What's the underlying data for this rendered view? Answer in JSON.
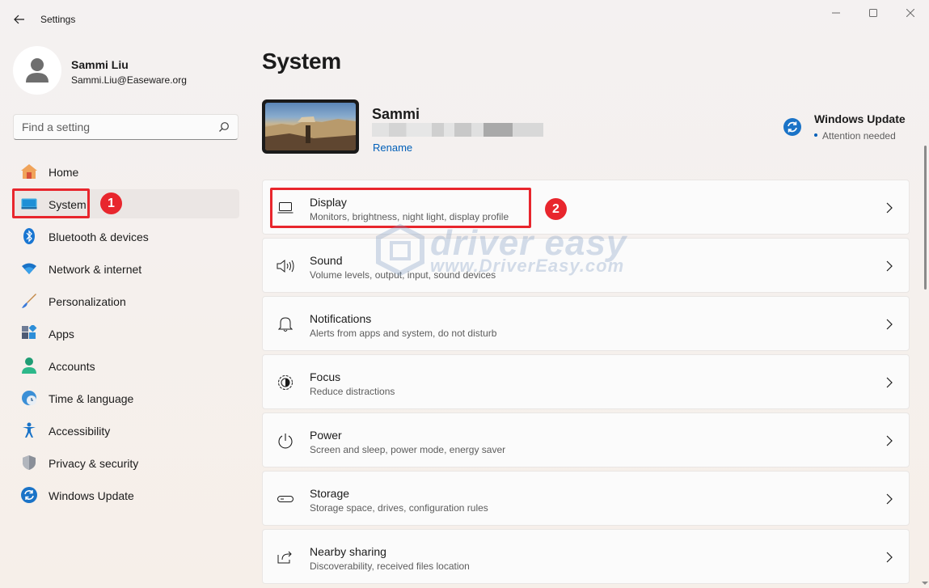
{
  "titlebar": {
    "app_title": "Settings",
    "back_icon": "arrow-left-icon",
    "minimize_icon": "minimize-icon",
    "maximize_icon": "maximize-icon",
    "close_icon": "close-icon"
  },
  "profile": {
    "name": "Sammi Liu",
    "email": "Sammi.Liu@Easeware.org",
    "avatar_icon": "person-icon"
  },
  "search": {
    "placeholder": "Find a setting",
    "value": "",
    "icon": "search-icon"
  },
  "sidebar": {
    "items": [
      {
        "label": "Home",
        "icon": "home-icon",
        "active": false
      },
      {
        "label": "System",
        "icon": "monitor-icon",
        "active": true
      },
      {
        "label": "Bluetooth & devices",
        "icon": "bluetooth-icon",
        "active": false
      },
      {
        "label": "Network & internet",
        "icon": "wifi-icon",
        "active": false
      },
      {
        "label": "Personalization",
        "icon": "brush-icon",
        "active": false
      },
      {
        "label": "Apps",
        "icon": "apps-icon",
        "active": false
      },
      {
        "label": "Accounts",
        "icon": "account-icon",
        "active": false
      },
      {
        "label": "Time & language",
        "icon": "clock-globe-icon",
        "active": false
      },
      {
        "label": "Accessibility",
        "icon": "accessibility-icon",
        "active": false
      },
      {
        "label": "Privacy & security",
        "icon": "shield-icon",
        "active": false
      },
      {
        "label": "Windows Update",
        "icon": "update-icon",
        "active": false
      }
    ]
  },
  "annotations": {
    "badge1": "1",
    "badge2": "2",
    "highlight_color": "#e8262d"
  },
  "main": {
    "title": "System",
    "device": {
      "name": "Sammi",
      "rename_label": "Rename"
    },
    "windows_update": {
      "title": "Windows Update",
      "status": "Attention needed"
    },
    "cards": [
      {
        "title": "Display",
        "subtitle": "Monitors, brightness, night light, display profile",
        "icon": "display-icon"
      },
      {
        "title": "Sound",
        "subtitle": "Volume levels, output, input, sound devices",
        "icon": "speaker-icon"
      },
      {
        "title": "Notifications",
        "subtitle": "Alerts from apps and system, do not disturb",
        "icon": "bell-icon"
      },
      {
        "title": "Focus",
        "subtitle": "Reduce distractions",
        "icon": "focus-icon"
      },
      {
        "title": "Power",
        "subtitle": "Screen and sleep, power mode, energy saver",
        "icon": "power-icon"
      },
      {
        "title": "Storage",
        "subtitle": "Storage space, drives, configuration rules",
        "icon": "storage-icon"
      },
      {
        "title": "Nearby sharing",
        "subtitle": "Discoverability, received files location",
        "icon": "share-icon"
      }
    ]
  },
  "watermark": {
    "brand": "driver easy",
    "url": "www.DriverEasy.com"
  },
  "colors": {
    "accent": "#005fb8",
    "sidebar_active_bg": "#ebe6e4",
    "card_bg": "#fbfbfb"
  }
}
